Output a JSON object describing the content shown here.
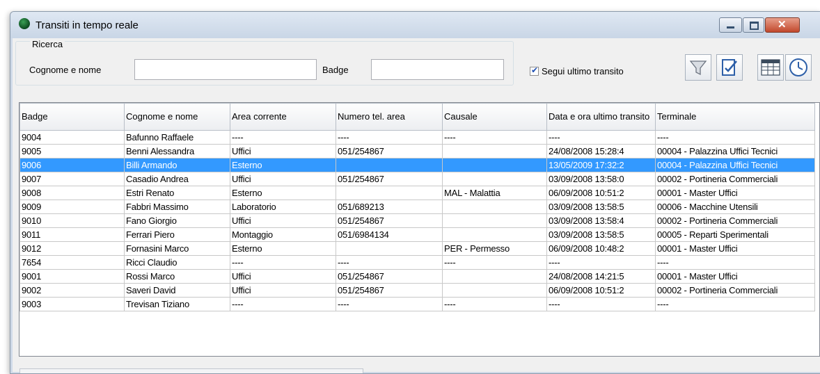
{
  "window": {
    "title": "Transiti in tempo reale"
  },
  "search": {
    "legend": "Ricerca",
    "name_label": "Cognome e nome",
    "name_value": "",
    "badge_label": "Badge",
    "badge_value": "",
    "follow_label": "Segui ultimo transito",
    "follow_checked": true
  },
  "toolbar": {
    "icons": [
      "filter-icon",
      "edit-document-icon",
      "report-table-icon",
      "clock-icon"
    ]
  },
  "grid": {
    "columns": [
      "Badge",
      "Cognome e nome",
      "Area corrente",
      "Numero tel. area",
      "Causale",
      "Data e ora ultimo transito",
      "Terminale"
    ],
    "selected_index": 2,
    "rows": [
      [
        "9004",
        "Bafunno Raffaele",
        "----",
        "----",
        "----",
        "----",
        "----"
      ],
      [
        "9005",
        "Benni Alessandra",
        "Uffici",
        "051/254867",
        "",
        "24/08/2008 15:28:4",
        "00004 - Palazzina Uffici Tecnici"
      ],
      [
        "9006",
        "Billi Armando",
        "Esterno",
        "",
        "",
        "13/05/2009 17:32:2",
        "00004 - Palazzina Uffici Tecnici"
      ],
      [
        "9007",
        "Casadio Andrea",
        "Uffici",
        "051/254867",
        "",
        "03/09/2008 13:58:0",
        "00002 - Portineria Commerciali"
      ],
      [
        "9008",
        "Estri Renato",
        "Esterno",
        "",
        "MAL - Malattia",
        "06/09/2008 10:51:2",
        "00001 - Master Uffici"
      ],
      [
        "9009",
        "Fabbri Massimo",
        "Laboratorio",
        "051/689213",
        "",
        "03/09/2008 13:58:5",
        "00006 - Macchine Utensili"
      ],
      [
        "9010",
        "Fano Giorgio",
        "Uffici",
        "051/254867",
        "",
        "03/09/2008 13:58:4",
        "00002 - Portineria Commerciali"
      ],
      [
        "9011",
        "Ferrari Piero",
        "Montaggio",
        "051/6984134",
        "",
        "03/09/2008 13:58:5",
        "00005 - Reparti Sperimentali"
      ],
      [
        "9012",
        "Fornasini Marco",
        "Esterno",
        "",
        "PER - Permesso",
        "06/09/2008 10:48:2",
        "00001 - Master Uffici"
      ],
      [
        "7654",
        "Ricci Claudio",
        "----",
        "----",
        "----",
        "----",
        "----"
      ],
      [
        "9001",
        "Rossi Marco",
        "Uffici",
        "051/254867",
        "",
        "24/08/2008 14:21:5",
        "00001 - Master Uffici"
      ],
      [
        "9002",
        "Saveri David",
        "Uffici",
        "051/254867",
        "",
        "06/09/2008 10:51:2",
        "00002 - Portineria Commerciali"
      ],
      [
        "9003",
        "Trevisan Tiziano",
        "----",
        "----",
        "----",
        "----",
        "----"
      ]
    ]
  },
  "colors": {
    "selection": "#3399ff",
    "window_frame": "#cfdae8"
  }
}
